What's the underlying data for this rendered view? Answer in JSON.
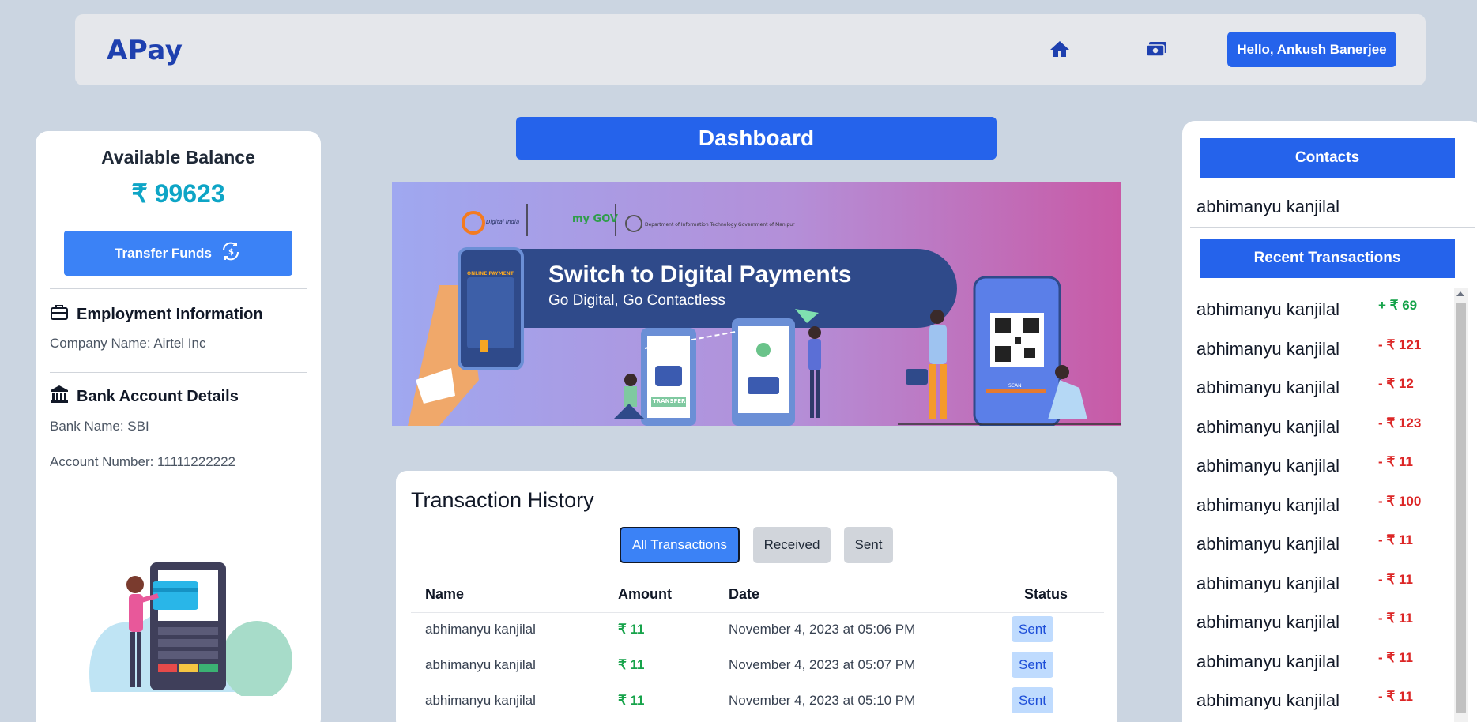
{
  "navbar": {
    "brand": "APay",
    "icons": [
      "home-icon",
      "money-icon"
    ],
    "greeting": "Hello, Ankush Banerjee"
  },
  "left": {
    "balance_title": "Available Balance",
    "balance_value": "₹ 99623",
    "transfer_label": "Transfer Funds",
    "employment_title": "Employment Information",
    "company": "Company Name: Airtel Inc",
    "bank_title": "Bank Account Details",
    "bank_name": "Bank Name: SBI",
    "account_number": "Account Number: 11111222222"
  },
  "center": {
    "dashboard_label": "Dashboard",
    "banner_title": "Switch to Digital Payments",
    "banner_subtitle": "Go Digital, Go Contactless",
    "banner_tags": {
      "online_payment": "ONLINE PAYMENT",
      "transfer": "TRANSFER",
      "scan": "SCAN",
      "digital_india": "Digital India",
      "mygov": "my GOV",
      "dept": "Department of Information Technology Government of Manipur"
    }
  },
  "history": {
    "title": "Transaction History",
    "filters": [
      "All Transactions",
      "Received",
      "Sent"
    ],
    "columns": [
      "Name",
      "Amount",
      "Date",
      "Status"
    ],
    "rows": [
      {
        "name": "abhimanyu kanjilal",
        "amount": "₹ 11",
        "date": "November 4, 2023 at 05:06 PM",
        "status": "Sent"
      },
      {
        "name": "abhimanyu kanjilal",
        "amount": "₹ 11",
        "date": "November 4, 2023 at 05:07 PM",
        "status": "Sent"
      },
      {
        "name": "abhimanyu kanjilal",
        "amount": "₹ 11",
        "date": "November 4, 2023 at 05:10 PM",
        "status": "Sent"
      }
    ]
  },
  "right": {
    "contacts_title": "Contacts",
    "contact": "abhimanyu kanjilal",
    "recent_title": "Recent Transactions",
    "transactions": [
      {
        "name": "abhimanyu kanjilal",
        "amount": "+ ₹ 69"
      },
      {
        "name": "abhimanyu kanjilal",
        "amount": "- ₹ 121"
      },
      {
        "name": "abhimanyu kanjilal",
        "amount": "- ₹ 12"
      },
      {
        "name": "abhimanyu kanjilal",
        "amount": "- ₹ 123"
      },
      {
        "name": "abhimanyu kanjilal",
        "amount": "- ₹ 11"
      },
      {
        "name": "abhimanyu kanjilal",
        "amount": "- ₹ 100"
      },
      {
        "name": "abhimanyu kanjilal",
        "amount": "- ₹ 11"
      },
      {
        "name": "abhimanyu kanjilal",
        "amount": "- ₹ 11"
      },
      {
        "name": "abhimanyu kanjilal",
        "amount": "- ₹ 11"
      },
      {
        "name": "abhimanyu kanjilal",
        "amount": "- ₹ 11"
      },
      {
        "name": "abhimanyu kanjilal",
        "amount": "- ₹ 11"
      }
    ]
  },
  "colors": {
    "brand": "#1e40af",
    "primary": "#2563eb",
    "balance": "#0ea5c6",
    "positive": "#16a34a",
    "negative": "#dc2626",
    "background": "#cbd5e1"
  }
}
